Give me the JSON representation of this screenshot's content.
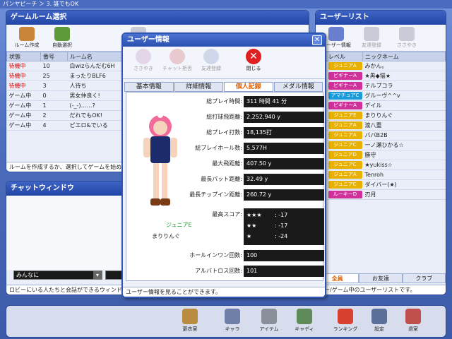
{
  "window": {
    "title": "パンヤピーチ ＞ 3. 誰でもOK"
  },
  "room_panel": {
    "title": "ゲームルーム選択",
    "toolbar": [
      "ルーム作成",
      "自動選択",
      "入場"
    ],
    "columns": [
      "状態",
      "番号",
      "ルーム名"
    ],
    "rows": [
      {
        "status": "待機中",
        "num": "10",
        "name": "白wizらんだむ6H",
        "red": true
      },
      {
        "status": "待機中",
        "num": "25",
        "name": "まったりBLF6",
        "red": true
      },
      {
        "status": "待機中",
        "num": "3",
        "name": "人待ち",
        "red": true
      },
      {
        "status": "ゲーム中",
        "num": "0",
        "name": "男女仲良く!",
        "red": false
      },
      {
        "status": "ゲーム中",
        "num": "1",
        "name": "(-_-)……?",
        "red": false
      },
      {
        "status": "ゲーム中",
        "num": "2",
        "name": "だれでもOK!",
        "red": false
      },
      {
        "status": "ゲーム中",
        "num": "4",
        "name": "ピエロ&でいる",
        "red": false
      }
    ],
    "footer": "ルームを作成するか、選択してゲームを始めて"
  },
  "chat_panel": {
    "title": "チャットウィンドウ",
    "target": "みんなに",
    "footer": "ロビーにいる人たちと会話ができるウィンドウ"
  },
  "user_panel": {
    "title": "ユーザーリスト",
    "toolbar": [
      "ユーザー情報",
      "友達登録",
      "ささやき"
    ],
    "columns": [
      "レベル",
      "ニックネーム"
    ],
    "users": [
      {
        "level": "ジュニアA",
        "nick": "みかん。",
        "sex": "f",
        "color": "#e8b000"
      },
      {
        "level": "ビギナーA",
        "nick": "★黒◆猫★",
        "sex": "m",
        "color": "#d0309a"
      },
      {
        "level": "ビギナーA",
        "nick": "テルプコラ",
        "sex": "m",
        "color": "#d0309a"
      },
      {
        "level": "アマチュアC",
        "nick": "グルーヴ^^v",
        "sex": "m",
        "color": "#1a9ad8"
      },
      {
        "level": "ビギナーA",
        "nick": "デイル",
        "sex": "m",
        "color": "#d0309a"
      },
      {
        "level": "ジュニアE",
        "nick": "まりりんぐ",
        "sex": "m",
        "color": "#e8b000"
      },
      {
        "level": "ジュニアA",
        "nick": "渡八重",
        "sex": "m",
        "color": "#e8b000"
      },
      {
        "level": "ジュニアA",
        "nick": "ババB2B",
        "sex": "m",
        "color": "#e8b000"
      },
      {
        "level": "ジュニアC",
        "nick": "一ノ瀬ひかる☆",
        "sex": "m",
        "color": "#e8b000"
      },
      {
        "level": "ジュニアD",
        "nick": "勝守",
        "sex": "m",
        "color": "#e8b000"
      },
      {
        "level": "ジュニアC",
        "nick": "★yukiss☆",
        "sex": "f",
        "color": "#e8b000"
      },
      {
        "level": "ジュニアA",
        "nick": "Tenroh",
        "sex": "m",
        "color": "#e8b000"
      },
      {
        "level": "ジュニアC",
        "nick": "ダイバー(★)",
        "sex": "m",
        "color": "#e8b000"
      },
      {
        "level": "ルーキーD",
        "nick": "刃月",
        "sex": "m",
        "color": "#d0309a"
      }
    ],
    "tabs": [
      "全員",
      "お友達",
      "クラブ"
    ],
    "footer": "ビー/ゲーム中のユーザーリストです。"
  },
  "dialog": {
    "title": "ユーザー情報",
    "toolbar": [
      {
        "label": "ささやき",
        "disabled": true
      },
      {
        "label": "チャット拒否",
        "disabled": true
      },
      {
        "label": "友達登録",
        "disabled": true
      },
      {
        "label": "閉じる",
        "disabled": false
      }
    ],
    "tabs": [
      "基本情報",
      "詳細情報",
      "個人記録",
      "メダル情報"
    ],
    "active_tab": "個人記録",
    "character": {
      "level": "ジュニアE",
      "name": "まりりんぐ"
    },
    "stats": [
      {
        "label": "総プレイ時間:",
        "value": "311 時間 41 分"
      },
      {
        "label": "総打球飛距離:",
        "value": "2,252,940 y"
      },
      {
        "label": "総プレイ打数:",
        "value": "18,135打"
      },
      {
        "label": "総プレイホール数:",
        "value": "5,577H"
      },
      {
        "label": "最大飛距離:",
        "value": "407.50 y"
      },
      {
        "label": "最長パット距離:",
        "value": "32.49 y"
      },
      {
        "label": "最長チップイン距離:",
        "value": "260.72 y"
      }
    ],
    "best_score_label": "最高スコア:",
    "best_scores": [
      {
        "stars": "★★★",
        "score": ": -17"
      },
      {
        "stars": "★★",
        "score": ": -17"
      },
      {
        "stars": "★",
        "score": ": -24"
      }
    ],
    "holeinone": {
      "label": "ホールインワン回数:",
      "value": "100"
    },
    "albatross": {
      "label": "アルバトロス回数:",
      "value": "101"
    },
    "status": "ユーザー情報を見ることができます。"
  },
  "bottom": [
    "更衣室",
    "キャラ",
    "アイテム",
    "キャディ",
    "ランキング",
    "設定",
    "退室"
  ]
}
